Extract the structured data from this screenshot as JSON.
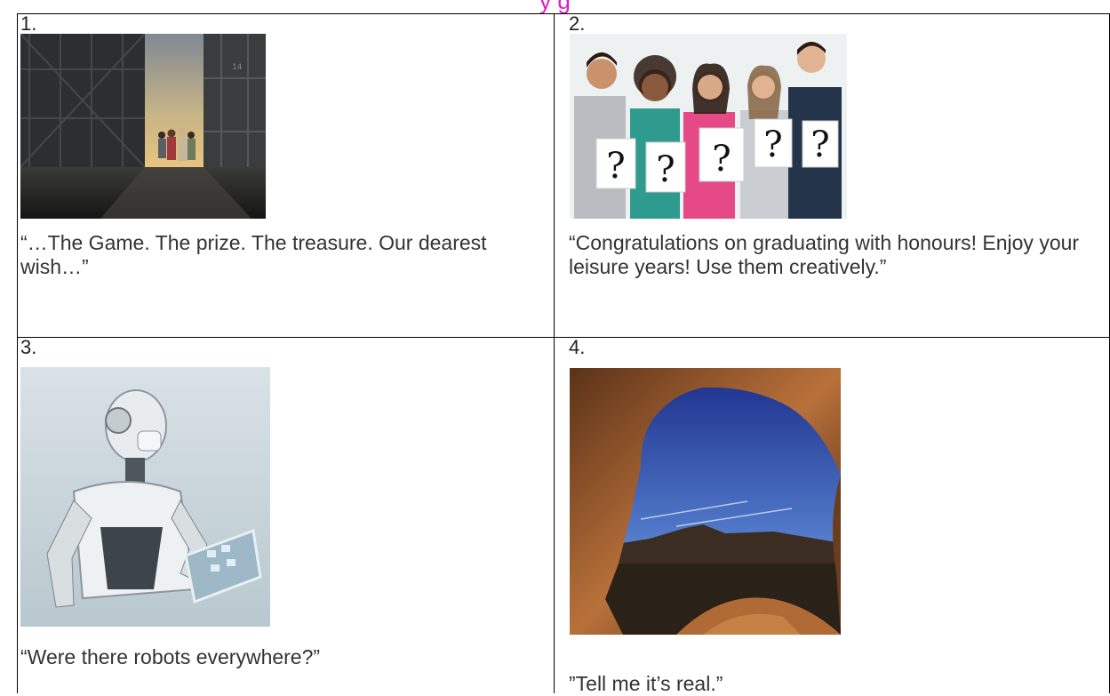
{
  "page": {
    "heading": "y      g"
  },
  "cells": [
    {
      "number": "1.",
      "caption": "“…The Game.  The prize.  The treasure.  Our dearest wish…”",
      "image": "dark-warehouse-doorway-photo"
    },
    {
      "number": "2.",
      "caption": "“Congratulations on graduating with honours! Enjoy your leisure years!  Use them creatively.”",
      "image": "students-holding-question-marks-photo",
      "sign_text": "?"
    },
    {
      "number": "3.",
      "caption": "“Were there robots everywhere?”",
      "image": "robot-holding-tablet-photo"
    },
    {
      "number": "4.",
      "caption": "”Tell me it’s real.”",
      "image": "desert-cave-sky-photo"
    }
  ],
  "colors": {
    "heading": "#e01bc9",
    "border": "#000000",
    "text": "#222222"
  }
}
